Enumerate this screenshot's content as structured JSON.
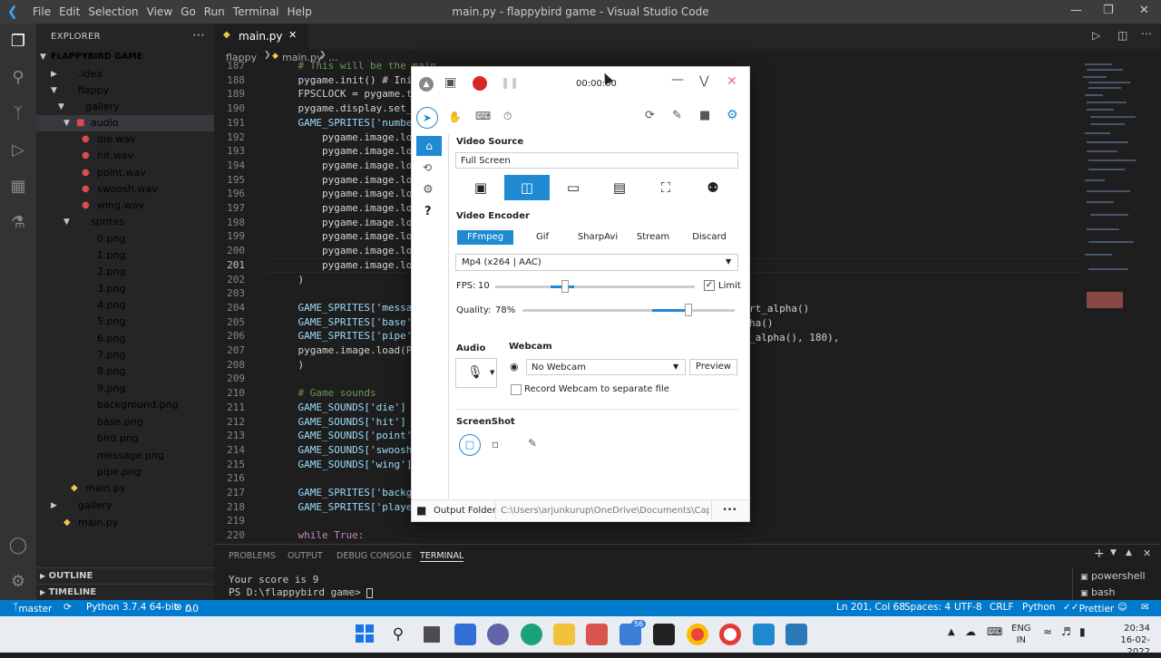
{
  "titlebar": {
    "menu": [
      "File",
      "Edit",
      "Selection",
      "View",
      "Go",
      "Run",
      "Terminal",
      "Help"
    ],
    "window_title": "main.py - flappybird game - Visual Studio Code"
  },
  "sidebar": {
    "header": "EXPLORER",
    "root": "FLAPPYBIRD GAME",
    "items": [
      {
        "label": ".idea"
      },
      {
        "label": "flappy"
      },
      {
        "label": "gallery"
      },
      {
        "label": "audio"
      },
      {
        "label": "die.wav"
      },
      {
        "label": "hit.wav"
      },
      {
        "label": "point.wav"
      },
      {
        "label": "swoosh.wav"
      },
      {
        "label": "wing.wav"
      },
      {
        "label": "sprites"
      },
      {
        "label": "0.png"
      },
      {
        "label": "1.png"
      },
      {
        "label": "2.png"
      },
      {
        "label": "3.png"
      },
      {
        "label": "4.png"
      },
      {
        "label": "5.png"
      },
      {
        "label": "6.png"
      },
      {
        "label": "7.png"
      },
      {
        "label": "8.png"
      },
      {
        "label": "9.png"
      },
      {
        "label": "background.png"
      },
      {
        "label": "base.png"
      },
      {
        "label": "bird.png"
      },
      {
        "label": "message.png"
      },
      {
        "label": "pipe.png"
      },
      {
        "label": "main.py"
      },
      {
        "label": "gallery"
      },
      {
        "label": "main.py"
      }
    ],
    "outline": "OUTLINE",
    "timeline": "TIMELINE"
  },
  "editor": {
    "tab": "main.py",
    "breadcrumb": [
      "flappy",
      "main.py",
      "..."
    ],
    "lines": [
      {
        "n": "187",
        "code": "    # This will be the main"
      },
      {
        "n": "188",
        "code": "    pygame.init() # Initi"
      },
      {
        "n": "189",
        "code": "    FPSCLOCK = pygame.tim"
      },
      {
        "n": "190",
        "code": "    pygame.display.set_ca"
      },
      {
        "n": "191",
        "code": "    GAME_SPRITES['numbers"
      },
      {
        "n": "192",
        "code": "        pygame.image.load"
      },
      {
        "n": "193",
        "code": "        pygame.image.load"
      },
      {
        "n": "194",
        "code": "        pygame.image.load"
      },
      {
        "n": "195",
        "code": "        pygame.image.load"
      },
      {
        "n": "196",
        "code": "        pygame.image.load"
      },
      {
        "n": "197",
        "code": "        pygame.image.load"
      },
      {
        "n": "198",
        "code": "        pygame.image.load"
      },
      {
        "n": "199",
        "code": "        pygame.image.load"
      },
      {
        "n": "200",
        "code": "        pygame.image.load"
      },
      {
        "n": "201",
        "code": "        pygame.image.load"
      },
      {
        "n": "202",
        "code": "    )"
      },
      {
        "n": "203",
        "code": ""
      },
      {
        "n": "204",
        "code": "    GAME_SPRITES['message"
      },
      {
        "n": "205",
        "code": "    GAME_SPRITES['base']"
      },
      {
        "n": "206",
        "code": "    GAME_SPRITES['pipe']"
      },
      {
        "n": "207",
        "code": "    pygame.image.load(PIP"
      },
      {
        "n": "208",
        "code": "    )"
      },
      {
        "n": "209",
        "code": ""
      },
      {
        "n": "210",
        "code": "    # Game sounds"
      },
      {
        "n": "211",
        "code": "    GAME_SOUNDS['die'] ="
      },
      {
        "n": "212",
        "code": "    GAME_SOUNDS['hit'] ="
      },
      {
        "n": "213",
        "code": "    GAME_SOUNDS['point']"
      },
      {
        "n": "214",
        "code": "    GAME_SOUNDS['swoosh']"
      },
      {
        "n": "215",
        "code": "    GAME_SOUNDS['wing'] ="
      },
      {
        "n": "216",
        "code": ""
      },
      {
        "n": "217",
        "code": "    GAME_SPRITES['backgro"
      },
      {
        "n": "218",
        "code": "    GAME_SPRITES['player'"
      },
      {
        "n": "219",
        "code": ""
      },
      {
        "n": "220",
        "code": "    while True:"
      }
    ],
    "right_fragments": [
      "rt_alpha()",
      "ha()",
      "_alpha(), 180),"
    ]
  },
  "panel": {
    "tabs": [
      "PROBLEMS",
      "OUTPUT",
      "DEBUG CONSOLE",
      "TERMINAL"
    ],
    "terminal_lines": [
      "Your score is 9",
      "PS D:\\flappybird game> "
    ],
    "terminals": [
      "powershell",
      "bash"
    ]
  },
  "statusbar": {
    "branch": "master",
    "python": "Python 3.7.4 64-bit",
    "problems": "0",
    "warnings": "0",
    "position": "Ln 201, Col 68",
    "spaces": "Spaces: 4",
    "encoding": "UTF-8",
    "eol": "CRLF",
    "language": "Python",
    "prettier": "Prettier"
  },
  "taskbar": {
    "lang": "ENG",
    "region": "IN",
    "time": "20:34",
    "date": "16-02-2022",
    "badge": "56"
  },
  "captura": {
    "timer": "00:00:00",
    "video_source_label": "Video Source",
    "video_source_value": "Full Screen",
    "video_encoder_label": "Video Encoder",
    "encoders": [
      "FFmpeg",
      "Gif",
      "SharpAvi",
      "Stream",
      "Discard"
    ],
    "codec": "Mp4 (x264 | AAC)",
    "fps_label": "FPS:",
    "fps_value": "10",
    "fps_fraction": 0.35,
    "limit_label": "Limit",
    "quality_label": "Quality:",
    "quality_value": "78%",
    "quality_fraction": 0.78,
    "audio_label": "Audio",
    "webcam_label": "Webcam",
    "webcam_value": "No Webcam",
    "preview_label": "Preview",
    "record_webcam_label": "Record Webcam to separate file",
    "screenshot_label": "ScreenShot",
    "output_folder_label": "Output Folder",
    "output_path": "C:\\Users\\arjunkurup\\OneDrive\\Documents\\Captura",
    "more": "•••"
  }
}
